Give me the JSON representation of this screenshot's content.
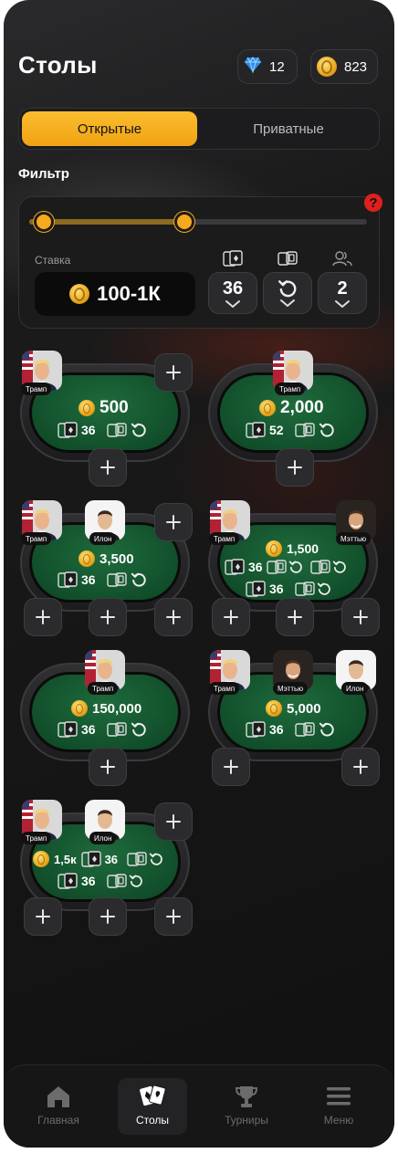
{
  "header": {
    "title": "Столы"
  },
  "currency": {
    "gems": "12",
    "coins": "823"
  },
  "segments": {
    "open": "Открытые",
    "private": "Приватные"
  },
  "filter": {
    "title": "Фильтр",
    "help": "?",
    "stake_label": "Ставка",
    "stake_value": "100-1К",
    "cards": "36",
    "players": "2"
  },
  "tables": [
    {
      "stake": "500",
      "cards": "36",
      "players": [
        {
          "name": "Трамп"
        }
      ]
    },
    {
      "stake": "2,000",
      "cards": "52",
      "players": [
        {
          "name": "Трамп"
        }
      ]
    },
    {
      "stake": "3,500",
      "cards": "36",
      "players": [
        {
          "name": "Трамп"
        },
        {
          "name": "Илон"
        }
      ]
    },
    {
      "stake": "1,500",
      "cards": "36",
      "cards2": "36",
      "players": [
        {
          "name": "Трамп"
        },
        {
          "name": "Мэттью"
        }
      ]
    },
    {
      "stake": "150,000",
      "cards": "36",
      "players": [
        {
          "name": "Трамп"
        }
      ]
    },
    {
      "stake": "5,000",
      "cards": "36",
      "players": [
        {
          "name": "Трамп"
        },
        {
          "name": "Мэттью"
        },
        {
          "name": "Илон"
        }
      ]
    },
    {
      "stake": "1,5к",
      "cards": "36",
      "cards2": "36",
      "players": [
        {
          "name": "Трамп"
        },
        {
          "name": "Илон"
        }
      ]
    }
  ],
  "nav": {
    "home": "Главная",
    "tables": "Столы",
    "tournaments": "Турниры",
    "menu": "Меню"
  },
  "colors": {
    "accent": "#f5aa1c",
    "felt": "#145a30",
    "help": "#e0201c"
  }
}
